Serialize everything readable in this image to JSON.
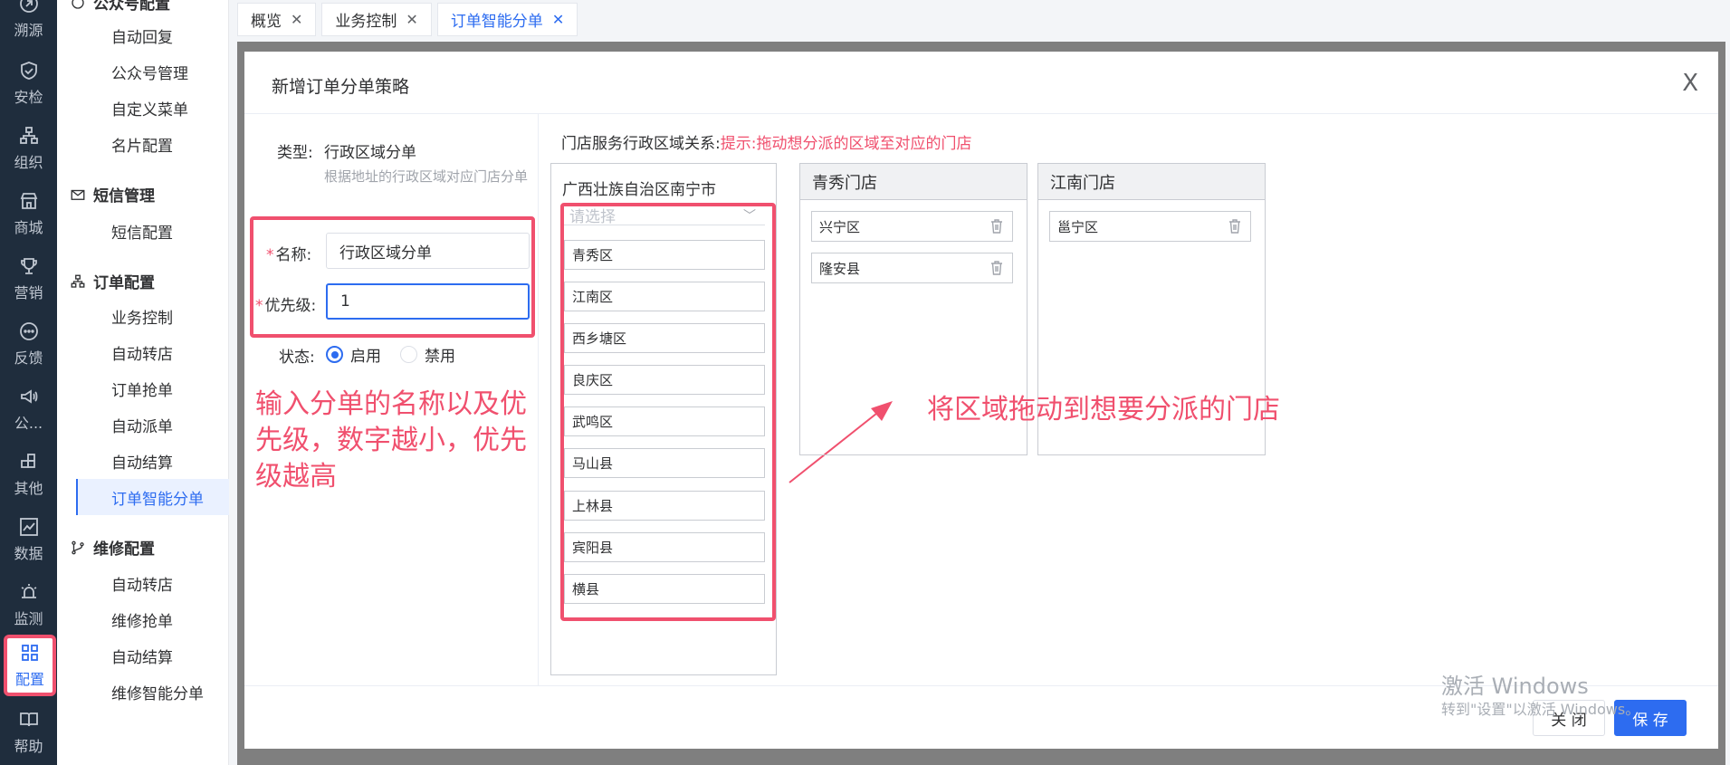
{
  "rail": [
    {
      "label": "溯源",
      "icon": "trace-icon"
    },
    {
      "label": "安检",
      "icon": "shield-check-icon"
    },
    {
      "label": "组织",
      "icon": "org-chart-icon"
    },
    {
      "label": "商城",
      "icon": "store-icon"
    },
    {
      "label": "营销",
      "icon": "trophy-icon"
    },
    {
      "label": "反馈",
      "icon": "chat-bubble-icon"
    },
    {
      "label": "公...",
      "icon": "megaphone-icon"
    },
    {
      "label": "其他",
      "icon": "blocks-icon"
    },
    {
      "label": "数据",
      "icon": "line-chart-icon"
    },
    {
      "label": "监测",
      "icon": "alarm-icon"
    },
    {
      "label": "配置",
      "icon": "grid-icon",
      "active": true
    },
    {
      "label": "帮助",
      "icon": "book-icon"
    }
  ],
  "submenu": {
    "groups": {
      "official": "公众号配置",
      "sms": "短信管理",
      "order": "订单配置",
      "repair": "维修配置"
    },
    "official_items": [
      "自动回复",
      "公众号管理",
      "自定义菜单",
      "名片配置"
    ],
    "sms_items": [
      "短信配置"
    ],
    "order_items": [
      "业务控制",
      "自动转店",
      "订单抢单",
      "自动派单",
      "自动结算",
      "订单智能分单"
    ],
    "repair_items": [
      "自动转店",
      "维修抢单",
      "自动结算",
      "维修智能分单"
    ]
  },
  "tabs": [
    {
      "label": "概览"
    },
    {
      "label": "业务控制"
    },
    {
      "label": "订单智能分单",
      "active": true
    }
  ],
  "dialog": {
    "title": "新增订单分单策略",
    "close": "X",
    "type_label": "类型:",
    "type_value": "行政区域分单",
    "type_hint": "根据地址的行政区域对应门店分单",
    "name_label": "名称:",
    "name_value": "行政区域分单",
    "priority_label": "优先级:",
    "priority_value": "1",
    "status_label": "状态:",
    "status_enabled": "启用",
    "status_disabled": "禁用",
    "relation_label": "门店服务行政区域关系:",
    "relation_tip": "提示:拖动想分派的区域至对应的门店",
    "source_title": "广西壮族自治区南宁市",
    "select_placeholder": "请选择",
    "regions": [
      "青秀区",
      "江南区",
      "西乡塘区",
      "良庆区",
      "武鸣区",
      "马山县",
      "上林县",
      "宾阳县",
      "横县"
    ],
    "stores": [
      {
        "name": "青秀门店",
        "regions": [
          "兴宁区",
          "隆安县"
        ]
      },
      {
        "name": "江南门店",
        "regions": [
          "邕宁区"
        ]
      }
    ],
    "annotation_left": "输入分单的名称以及优先级，数字越小，优先级越高",
    "annotation_right": "将区域拖动到想要分派的门店",
    "btn_close": "关 闭",
    "btn_save": "保 存"
  },
  "watermark": {
    "line1": "激活 Windows",
    "line2": "转到\"设置\"以激活 Windows。"
  },
  "colors": {
    "accent": "#2d6cf0",
    "annotation": "#f0506e",
    "rail_bg": "#1f2d3d"
  }
}
